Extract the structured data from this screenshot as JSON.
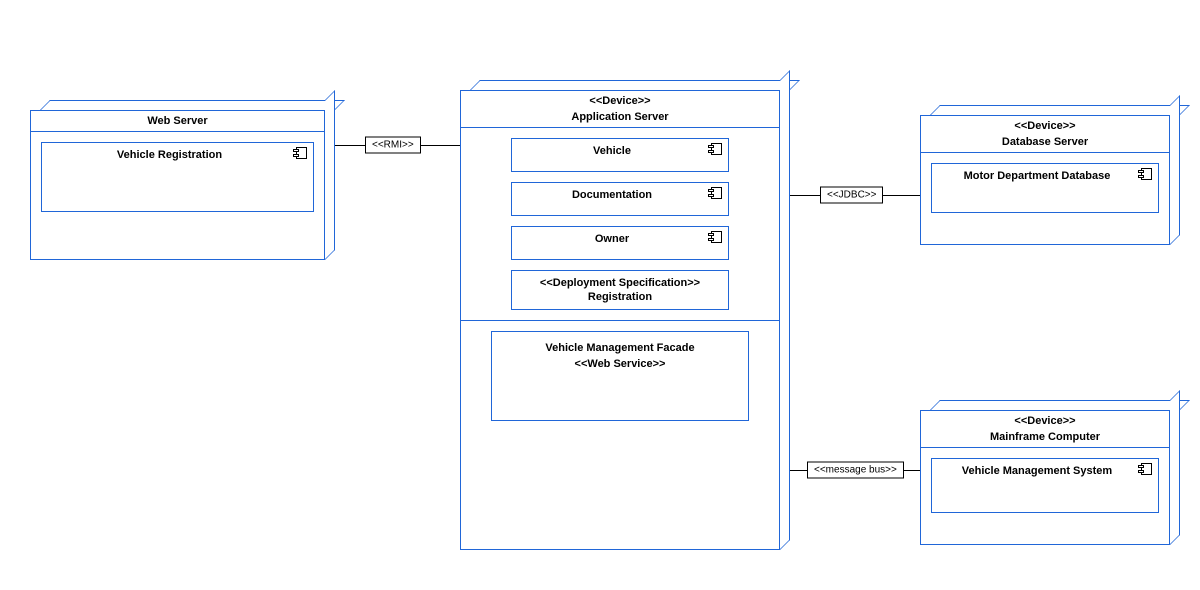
{
  "nodes": {
    "web_server": {
      "title": "Web Server",
      "components": [
        {
          "name": "Vehicle Registration"
        }
      ]
    },
    "app_server": {
      "stereotype": "<<Device>>",
      "title": "Application Server",
      "components": [
        {
          "name": "Vehicle"
        },
        {
          "name": "Documentation"
        },
        {
          "name": "Owner"
        }
      ],
      "deploy_spec": {
        "stereotype": "<<Deployment Specification>>",
        "name": "Registration"
      },
      "facade": {
        "name": "Vehicle Management Facade",
        "stereotype": "<<Web Service>>"
      }
    },
    "db_server": {
      "stereotype": "<<Device>>",
      "title": "Database Server",
      "components": [
        {
          "name": "Motor Department Database"
        }
      ]
    },
    "mainframe": {
      "stereotype": "<<Device>>",
      "title": "Mainframe Computer",
      "components": [
        {
          "name": "Vehicle Management System"
        }
      ]
    }
  },
  "connectors": {
    "rmi": "<<RMI>>",
    "jdbc": "<<JDBC>>",
    "msgbus": "<<message bus>>"
  }
}
